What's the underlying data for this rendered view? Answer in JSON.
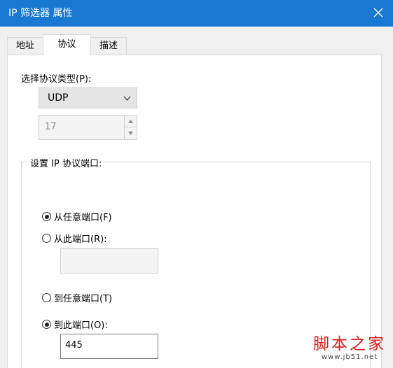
{
  "window": {
    "title": "IP 筛选器 属性",
    "close_icon": "close-icon"
  },
  "tabs": [
    {
      "label": "地址",
      "active": false
    },
    {
      "label": "协议",
      "active": true
    },
    {
      "label": "描述",
      "active": false
    }
  ],
  "protocol": {
    "type_label": "选择协议类型(P):",
    "type_value": "UDP",
    "number_value": "17"
  },
  "ports": {
    "group_label": "设置 IP 协议端口:",
    "from_any_label": "从任意端口(F)",
    "from_this_label": "从此端口(R):",
    "from_this_value": "",
    "to_any_label": "到任意端口(T)",
    "to_this_label": "到此端口(O):",
    "to_this_value": "445",
    "from_selected": "from_any",
    "to_selected": "to_this"
  },
  "watermark": {
    "title": "脚本之家",
    "url": "www.jb51.net"
  },
  "colors": {
    "titlebar": "#1978d2",
    "watermark": "#e2211c"
  }
}
